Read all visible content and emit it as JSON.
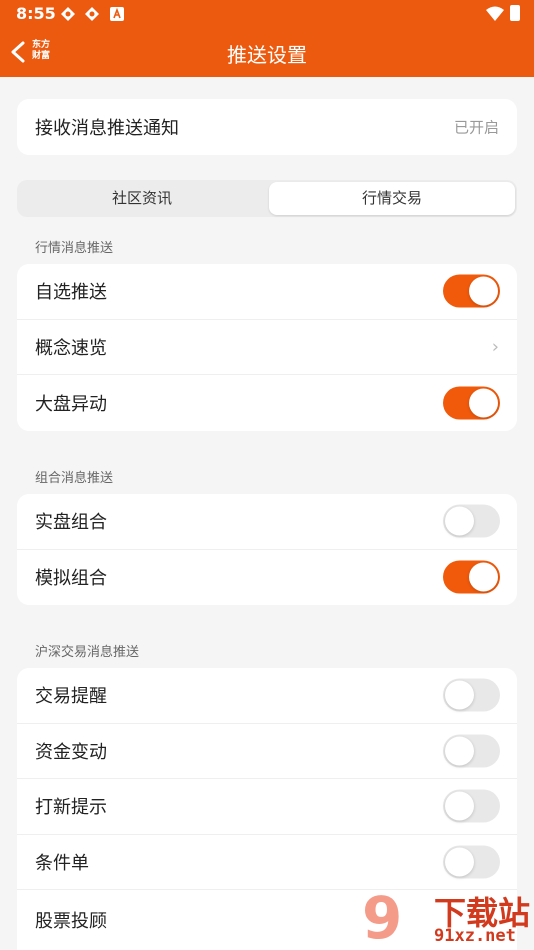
{
  "status_bar": {
    "time": "8:55"
  },
  "header": {
    "title": "推送设置",
    "logo_line1": "东方",
    "logo_line2": "财富"
  },
  "receive": {
    "label": "接收消息推送通知",
    "status": "已开启"
  },
  "tabs": [
    {
      "label": "社区资讯",
      "selected": false
    },
    {
      "label": "行情交易",
      "selected": true
    }
  ],
  "sections": [
    {
      "title": "行情消息推送",
      "rows": [
        {
          "label": "自选推送",
          "control": "toggle",
          "on": true
        },
        {
          "label": "概念速览",
          "control": "chevron"
        },
        {
          "label": "大盘异动",
          "control": "toggle",
          "on": true
        }
      ]
    },
    {
      "title": "组合消息推送",
      "rows": [
        {
          "label": "实盘组合",
          "control": "toggle",
          "on": false
        },
        {
          "label": "模拟组合",
          "control": "toggle",
          "on": true
        }
      ]
    },
    {
      "title": "沪深交易消息推送",
      "rows": [
        {
          "label": "交易提醒",
          "control": "toggle",
          "on": false
        },
        {
          "label": "资金变动",
          "control": "toggle",
          "on": false
        },
        {
          "label": "打新提示",
          "control": "toggle",
          "on": false
        },
        {
          "label": "条件单",
          "control": "toggle",
          "on": false
        },
        {
          "label": "股票投顾",
          "control": "none"
        }
      ]
    }
  ],
  "watermark": {
    "brand": "下载站",
    "url": "91xz.net",
    "digit": "9"
  },
  "colors": {
    "accent": "#ec5a0f",
    "toggle_on": "#f15a0b",
    "toggle_off": "#e8e8e8"
  }
}
